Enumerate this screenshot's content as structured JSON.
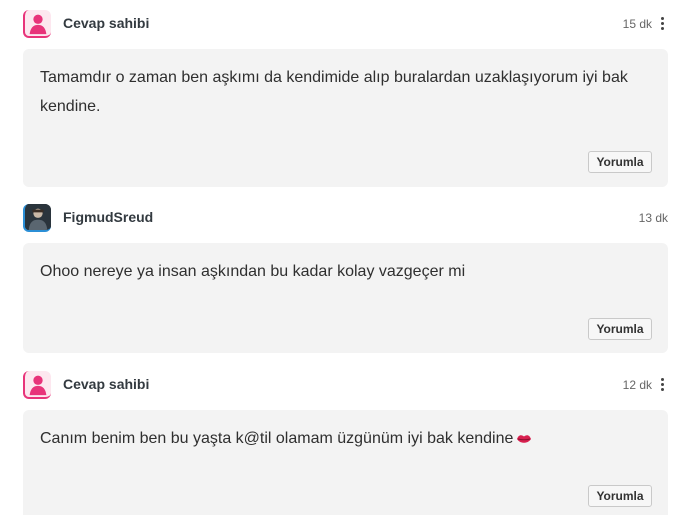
{
  "comments": [
    {
      "author": "Cevap sahibi",
      "role": "owner",
      "time": "15 dk",
      "text": "Tamamdır o zaman ben aşkımı da kendimide alıp buralardan uzaklaşıyorum iyi bak kendine.",
      "reply_label": "Yorumla",
      "has_menu": true
    },
    {
      "author": "FigmudSreud",
      "role": "user",
      "time": "13 dk",
      "text": "Ohoo nereye ya insan aşkından bu kadar kolay vazgeçer mi",
      "reply_label": "Yorumla",
      "has_menu": false
    },
    {
      "author": "Cevap sahibi",
      "role": "owner",
      "time": "12 dk",
      "text": "Canım benim ben bu yaşta k@til olamam üzgünüm iyi bak kendine",
      "emoji": "kiss-mark-icon",
      "reply_label": "Yorumla",
      "has_menu": true
    }
  ],
  "colors": {
    "owner_accent": "#e8337a",
    "user_accent": "#2b8fd6",
    "bubble_bg": "#f3f3f3"
  }
}
